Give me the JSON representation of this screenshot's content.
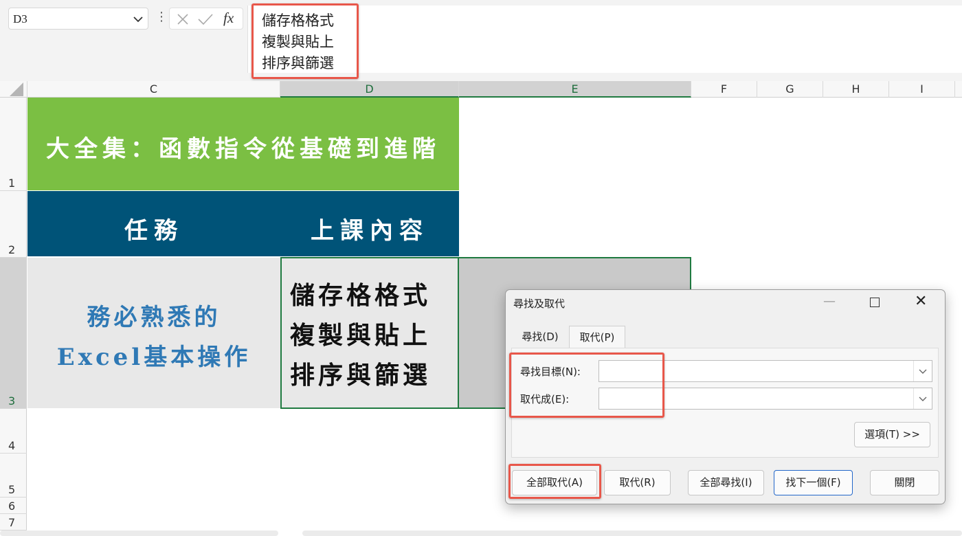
{
  "formula_bar": {
    "name_box": "D3",
    "fx_label": "fx",
    "content": "儲存格格式\n複製與貼上\n排序與篩選"
  },
  "columns": [
    "C",
    "D",
    "E",
    "F",
    "G",
    "H",
    "I"
  ],
  "rows": [
    "1",
    "2",
    "3",
    "4",
    "5",
    "6",
    "7"
  ],
  "sheet": {
    "title": "大全集：函數指令從基礎到進階",
    "header_task": "任務",
    "header_content": "上課內容",
    "c3": "務必熟悉的\nExcel基本操作",
    "d3": "儲存格格式\n複製與貼上\n排序與篩選"
  },
  "dialog": {
    "title": "尋找及取代",
    "tab_find": "尋找(D)",
    "tab_replace": "取代(P)",
    "find_what_label": "尋找目標(N):",
    "find_what_value": "",
    "replace_with_label": "取代成(E):",
    "replace_with_value": "",
    "options_button": "選項(T) >>",
    "replace_all_button": "全部取代(A)",
    "replace_button": "取代(R)",
    "find_all_button": "全部尋找(I)",
    "find_next_button": "找下一個(F)",
    "close_button": "關閉"
  },
  "colors": {
    "title_green": "#7bbf43",
    "header_blue": "#005378",
    "c3_text_blue": "#2f79b5",
    "highlight_red": "#e8574a",
    "selection_green": "#1f7a40"
  }
}
